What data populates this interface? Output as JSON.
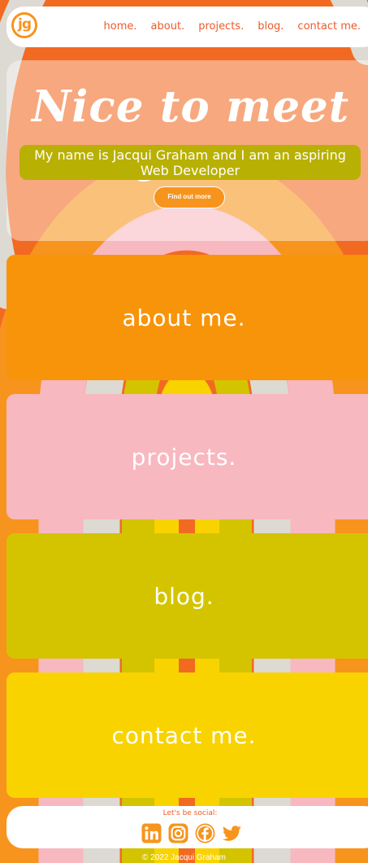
{
  "brand": {
    "logo_text": "jg"
  },
  "nav": {
    "links": [
      "home.",
      "about.",
      "projects.",
      "blog.",
      "contact me."
    ]
  },
  "hero": {
    "title": "Nice to meet you.",
    "subtitle": "My name is Jacqui Graham and I am an aspiring Web Developer",
    "button_label": "Find out more"
  },
  "cards": {
    "about": "about me.",
    "projects": "projects.",
    "blog": "blog.",
    "contact": "contact me."
  },
  "footer": {
    "social_label": "Let's be social:",
    "icons": [
      "linkedin-icon",
      "instagram-icon",
      "facebook-icon",
      "twitter-icon"
    ],
    "copyright": "© 2022 Jacqui Graham"
  },
  "colors": {
    "accent_orange": "#f7941d",
    "nav_text": "#ee5a2a",
    "pink": "#f8b8c0",
    "olive": "#d4c400",
    "yellow": "#f8d300"
  }
}
